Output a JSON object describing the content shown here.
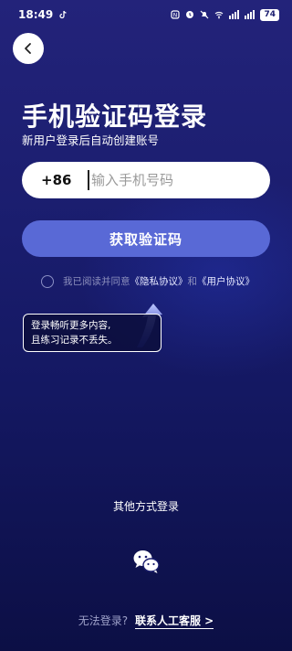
{
  "status_bar": {
    "time": "18:49",
    "battery": "74"
  },
  "header": {
    "title": "手机验证码登录",
    "subtitle": "新用户登录后自动创建账号"
  },
  "phone": {
    "country_code": "+86",
    "placeholder": "输入手机号码"
  },
  "actions": {
    "get_code_label": "获取验证码"
  },
  "agreement": {
    "prefix": "我已阅读并同意",
    "privacy_link": "《隐私协议》",
    "and": "和",
    "user_link": "《用户协议》"
  },
  "tooltip": {
    "line1": "登录畅听更多内容,",
    "line2": "且练习记录不丢失。"
  },
  "other_login": {
    "label": "其他方式登录"
  },
  "footer": {
    "cannot_login": "无法登录?",
    "contact": "联系人工客服 >"
  },
  "colors": {
    "accent": "#5969d6",
    "background_top": "#23237a",
    "background_bottom": "#0c0f45"
  }
}
